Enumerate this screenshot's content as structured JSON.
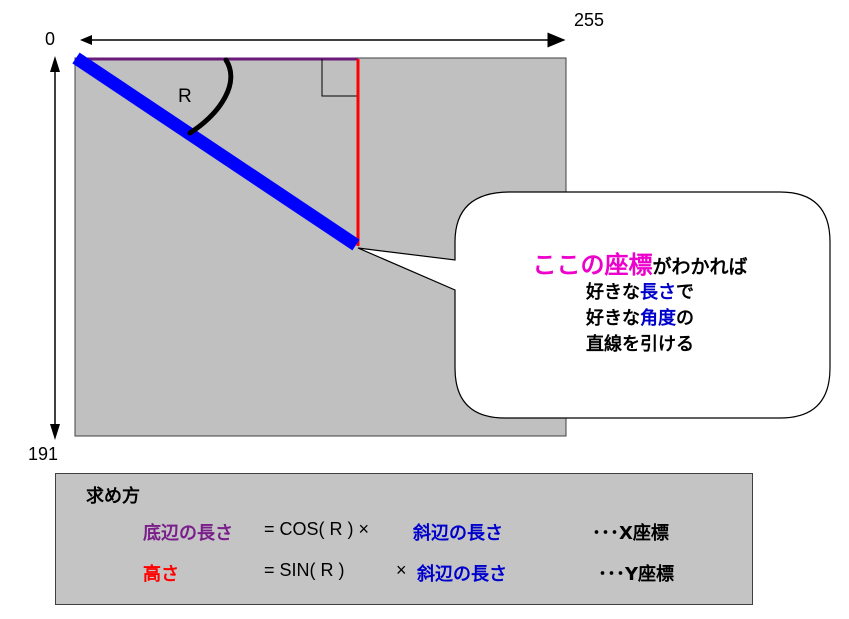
{
  "axis": {
    "origin_label": "0",
    "x_max_label": "255",
    "y_max_label": "191"
  },
  "angle_label": "R",
  "bubble": {
    "highlight": "ここの座標",
    "line1_rest": "がわかれば",
    "line2_pre": "好きな",
    "line2_blue": "長さ",
    "line2_post": "で",
    "line3_pre": "好きな",
    "line3_blue": "角度",
    "line3_post": "の",
    "line4": "直線を引ける"
  },
  "formula": {
    "title": "求め方",
    "row1": {
      "term": "底辺の長さ",
      "expr": "= COS( R ) ×",
      "hyp": "斜辺の長さ",
      "suffix": "･･･X座標"
    },
    "row2": {
      "term": "高さ",
      "expr": "= SIN( R )",
      "times": "×",
      "hyp": "斜辺の長さ",
      "suffix": "･･･Y座標"
    }
  },
  "colors": {
    "canvas_fill": "#c0c0c0",
    "base_line": "#6a1b7a",
    "height_line": "#ff0000",
    "hypotenuse": "#0000ff",
    "highlight": "#ee00cc",
    "emphasis_blue": "#0000cc"
  }
}
